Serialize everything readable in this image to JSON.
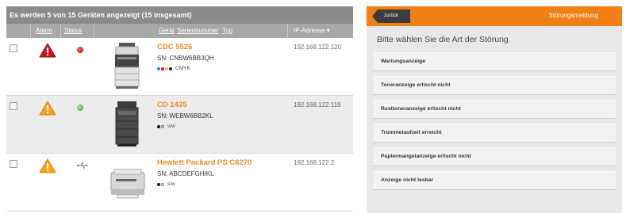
{
  "device_list": {
    "header": "Es werden 5 von 15 Geräten angezeigt (15 insgesamt)",
    "columns": {
      "alarm": "Alarm",
      "status": "Status",
      "device": "Gerät",
      "serial": "Seriennummer",
      "type": "Typ",
      "ip": "IP-Adresse ▾"
    },
    "rows": [
      {
        "name": "CDC 5526",
        "sn": "SN: CNBW6BB3QH",
        "color_mode": "CMYK",
        "ip": "192.168.122.120",
        "alarm": "red-warning-icon",
        "status": "red-status-led"
      },
      {
        "name": "CD 1435",
        "sn": "SN: WEBW6BB2KL",
        "color_mode": "s/w",
        "ip": "192.168.122.119",
        "alarm": "orange-warning-icon",
        "status": "green-status-led"
      },
      {
        "name": "Hewlett Packard PS C6270",
        "sn": "SN: ABCDEFGHIKL",
        "color_mode": "s/w",
        "ip": "192.168.122.2",
        "alarm": "orange-warning-icon",
        "status": "usb-icon"
      }
    ]
  },
  "fault_panel": {
    "back_label": "zurück",
    "title": "Störungsmeldung",
    "question": "Bitte wählen Sie die Art der Störung",
    "options": [
      "Wartungsanzeige",
      "Toneranzeige erlischt nicht",
      "Resttoneranzeige erlischt nicht",
      "Trommelaufzeit erreicht",
      "Papiermangelanzeige erlischt nicht",
      "Anzeige nicht lesbar"
    ]
  },
  "colors": {
    "accent_orange": "#f07f14",
    "device_name": "#e98b2a",
    "header_gray": "#8b8b8b"
  }
}
